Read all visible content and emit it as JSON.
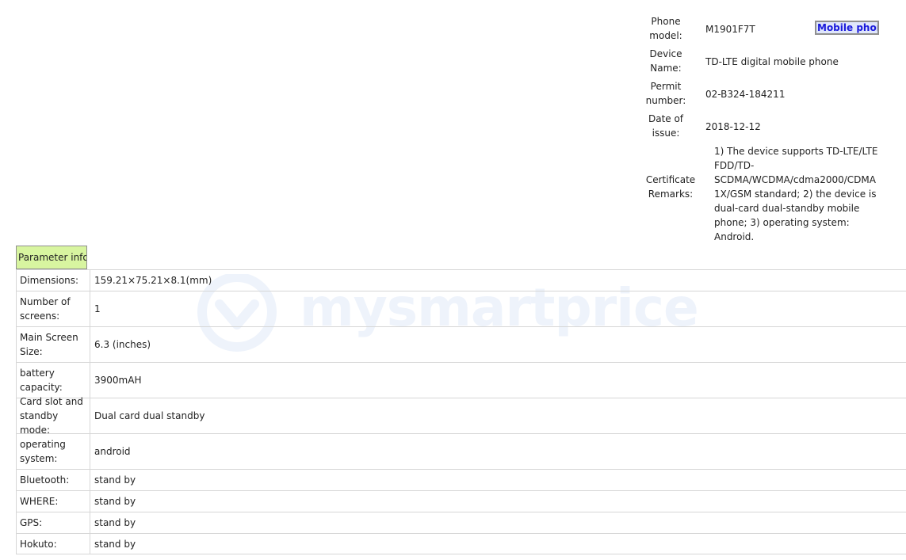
{
  "device_info": {
    "phone_model": {
      "label": "Phone model:",
      "value": "M1901F7T"
    },
    "device_name": {
      "label": "Device Name:",
      "value": "TD-LTE digital mobile phone"
    },
    "permit_number": {
      "label": "Permit number:",
      "value": "02-B324-184211"
    },
    "date_of_issue": {
      "label": "Date of issue:",
      "value": "2018-12-12"
    },
    "certificate_remarks": {
      "label": "Certificate Remarks:",
      "value": "1) The device supports TD-LTE/LTE FDD/TD-SCDMA/WCDMA/cdma2000/CDMA 1X/GSM standard; 2) the device is dual-card dual-standby mobile phone; 3) operating system: Android."
    },
    "mobile_tab": "Mobile phon"
  },
  "watermark": "mysmartprice",
  "parameters": {
    "header": "Parameter info",
    "rows": [
      {
        "label": "Dimensions:",
        "value": "159.21×75.21×8.1(mm)"
      },
      {
        "label": "Number of screens:",
        "value": "1"
      },
      {
        "label": "Main Screen Size:",
        "value": "6.3 (inches)"
      },
      {
        "label": "battery capacity:",
        "value": "3900mAH"
      },
      {
        "label": "Card slot and standby mode:",
        "value": "Dual card dual standby"
      },
      {
        "label": "operating system:",
        "value": "android"
      },
      {
        "label": "Bluetooth:",
        "value": "stand by"
      },
      {
        "label": "WHERE:",
        "value": "stand by"
      },
      {
        "label": "GPS:",
        "value": "stand by"
      },
      {
        "label": "Hokuto:",
        "value": "stand by"
      }
    ]
  },
  "colors": {
    "header_bg": "#d8f5a0",
    "tab_bg": "#dfe6fb",
    "tab_text": "#1a1adb",
    "border": "#d6d6d6"
  }
}
